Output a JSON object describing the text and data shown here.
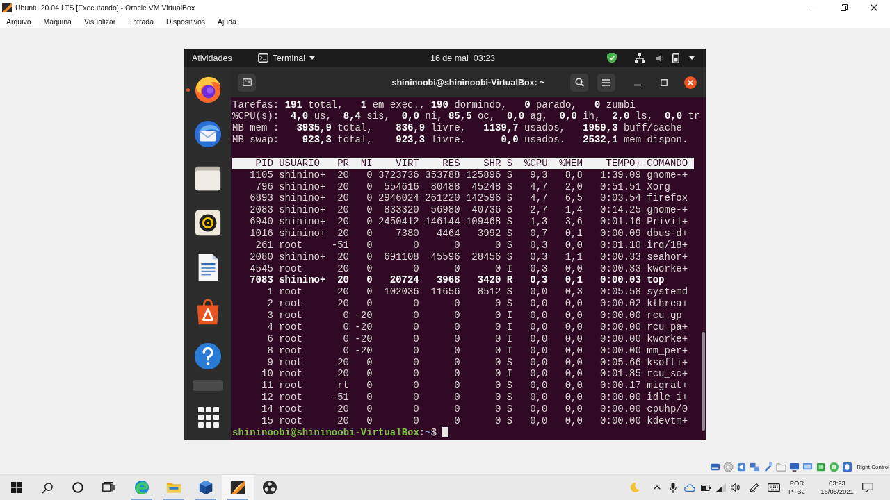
{
  "window": {
    "title": "Ubuntu 20.04 LTS [Executando] - Oracle VM VirtualBox"
  },
  "menu": [
    "Arquivo",
    "Máquina",
    "Visualizar",
    "Entrada",
    "Dispositivos",
    "Ajuda"
  ],
  "guest": {
    "top_bar": {
      "activities": "Atividades",
      "app_menu": "Terminal",
      "clock": "16 de mai  03:23"
    },
    "dock": [
      {
        "kind": "browser",
        "running": true
      },
      {
        "kind": "mail",
        "running": false
      },
      {
        "kind": "files",
        "running": false
      },
      {
        "kind": "music",
        "running": false
      },
      {
        "kind": "writer",
        "running": false
      },
      {
        "kind": "store",
        "running": false
      },
      {
        "kind": "help",
        "running": false
      },
      {
        "kind": "partial",
        "running": false
      },
      {
        "kind": "apps",
        "running": false
      }
    ],
    "terminal": {
      "title": "shininoobi@shininoobi-VirtualBox: ~",
      "summary": [
        "Tarefas: **191** total,   **1** em exec., **190** dormindo,   **0** parado,   **0** zumbi",
        "%CPU(s):  **4,0** us,  **8,4** sis,  **0,0** ni, **85,5** oc,  **0,0** ag,  **0,0** ih,  **2,0** ls,  **0,0** tr",
        "MB mem :   **3935,9** total,    **836,9** livre,   **1139,7** usados,   **1959,3** buff/cache",
        "MB swap:    **923,3** total,    **923,3** livre,      **0,0** usados.   **2532,1** mem dispon."
      ],
      "process_table": {
        "columns": [
          "PID",
          "USUARIO",
          "PR",
          "NI",
          "VIRT",
          "RES",
          "SHR",
          "S",
          "%CPU",
          "%MEM",
          "TEMPO+",
          "COMANDO"
        ],
        "rows": [
          {
            "cells": [
              "1105",
              "shinino+",
              "20",
              "0",
              "3723736",
              "353788",
              "125896",
              "S",
              "9,3",
              "8,8",
              "1:39.09",
              "gnome-+"
            ],
            "highlighted": false
          },
          {
            "cells": [
              "796",
              "shinino+",
              "20",
              "0",
              "554616",
              "80488",
              "45248",
              "S",
              "4,7",
              "2,0",
              "0:51.51",
              "Xorg"
            ],
            "highlighted": false
          },
          {
            "cells": [
              "6893",
              "shinino+",
              "20",
              "0",
              "2946024",
              "261220",
              "142596",
              "S",
              "4,7",
              "6,5",
              "0:03.54",
              "firefox"
            ],
            "highlighted": false
          },
          {
            "cells": [
              "2083",
              "shinino+",
              "20",
              "0",
              "833320",
              "56980",
              "40736",
              "S",
              "2,7",
              "1,4",
              "0:14.25",
              "gnome-+"
            ],
            "highlighted": false
          },
          {
            "cells": [
              "6940",
              "shinino+",
              "20",
              "0",
              "2450412",
              "146144",
              "109468",
              "S",
              "1,3",
              "3,6",
              "0:01.16",
              "Privil+"
            ],
            "highlighted": false
          },
          {
            "cells": [
              "1016",
              "shinino+",
              "20",
              "0",
              "7380",
              "4464",
              "3992",
              "S",
              "0,7",
              "0,1",
              "0:00.09",
              "dbus-d+"
            ],
            "highlighted": false
          },
          {
            "cells": [
              "261",
              "root",
              "-51",
              "0",
              "0",
              "0",
              "0",
              "S",
              "0,3",
              "0,0",
              "0:01.10",
              "irq/18+"
            ],
            "highlighted": false
          },
          {
            "cells": [
              "2080",
              "shinino+",
              "20",
              "0",
              "691108",
              "45596",
              "28456",
              "S",
              "0,3",
              "1,1",
              "0:00.33",
              "seahor+"
            ],
            "highlighted": false
          },
          {
            "cells": [
              "4545",
              "root",
              "20",
              "0",
              "0",
              "0",
              "0",
              "I",
              "0,3",
              "0,0",
              "0:00.33",
              "kworke+"
            ],
            "highlighted": false
          },
          {
            "cells": [
              "7083",
              "shinino+",
              "20",
              "0",
              "20724",
              "3968",
              "3420",
              "R",
              "0,3",
              "0,1",
              "0:00.03",
              "top"
            ],
            "highlighted": true
          },
          {
            "cells": [
              "1",
              "root",
              "20",
              "0",
              "102036",
              "11656",
              "8512",
              "S",
              "0,0",
              "0,3",
              "0:05.58",
              "systemd"
            ],
            "highlighted": false
          },
          {
            "cells": [
              "2",
              "root",
              "20",
              "0",
              "0",
              "0",
              "0",
              "S",
              "0,0",
              "0,0",
              "0:00.02",
              "kthrea+"
            ],
            "highlighted": false
          },
          {
            "cells": [
              "3",
              "root",
              "0",
              "-20",
              "0",
              "0",
              "0",
              "I",
              "0,0",
              "0,0",
              "0:00.00",
              "rcu_gp"
            ],
            "highlighted": false
          },
          {
            "cells": [
              "4",
              "root",
              "0",
              "-20",
              "0",
              "0",
              "0",
              "I",
              "0,0",
              "0,0",
              "0:00.00",
              "rcu_pa+"
            ],
            "highlighted": false
          },
          {
            "cells": [
              "6",
              "root",
              "0",
              "-20",
              "0",
              "0",
              "0",
              "I",
              "0,0",
              "0,0",
              "0:00.00",
              "kworke+"
            ],
            "highlighted": false
          },
          {
            "cells": [
              "8",
              "root",
              "0",
              "-20",
              "0",
              "0",
              "0",
              "I",
              "0,0",
              "0,0",
              "0:00.00",
              "mm_per+"
            ],
            "highlighted": false
          },
          {
            "cells": [
              "9",
              "root",
              "20",
              "0",
              "0",
              "0",
              "0",
              "S",
              "0,0",
              "0,0",
              "0:05.66",
              "ksofti+"
            ],
            "highlighted": false
          },
          {
            "cells": [
              "10",
              "root",
              "20",
              "0",
              "0",
              "0",
              "0",
              "I",
              "0,0",
              "0,0",
              "0:01.85",
              "rcu_sc+"
            ],
            "highlighted": false
          },
          {
            "cells": [
              "11",
              "root",
              "rt",
              "0",
              "0",
              "0",
              "0",
              "S",
              "0,0",
              "0,0",
              "0:00.17",
              "migrat+"
            ],
            "highlighted": false
          },
          {
            "cells": [
              "12",
              "root",
              "-51",
              "0",
              "0",
              "0",
              "0",
              "S",
              "0,0",
              "0,0",
              "0:00.00",
              "idle_i+"
            ],
            "highlighted": false
          },
          {
            "cells": [
              "14",
              "root",
              "20",
              "0",
              "0",
              "0",
              "0",
              "S",
              "0,0",
              "0,0",
              "0:00.00",
              "cpuhp/0"
            ],
            "highlighted": false
          },
          {
            "cells": [
              "15",
              "root",
              "20",
              "0",
              "0",
              "0",
              "0",
              "S",
              "0,0",
              "0,0",
              "0:00.00",
              "kdevtm+"
            ],
            "highlighted": false
          }
        ]
      },
      "prompt": {
        "user_host": "shininoobi@shininoobi-VirtualBox",
        "separator": ":",
        "path": "~",
        "symbol": "$"
      }
    }
  },
  "vbox_status": {
    "host_key": "Right Control"
  },
  "taskbar": {
    "apps": [
      {
        "kind": "browser",
        "running": true,
        "selected": false
      },
      {
        "kind": "folder",
        "running": true,
        "selected": false
      },
      {
        "kind": "cube",
        "running": true,
        "selected": false
      },
      {
        "kind": "vm",
        "running": true,
        "selected": true
      },
      {
        "kind": "recorder",
        "running": false,
        "selected": false
      }
    ],
    "tray": {
      "input_language": {
        "language": "POR",
        "layout": "PTB2"
      },
      "clock": {
        "time": "03:23",
        "date": "16/05/2021"
      }
    }
  }
}
